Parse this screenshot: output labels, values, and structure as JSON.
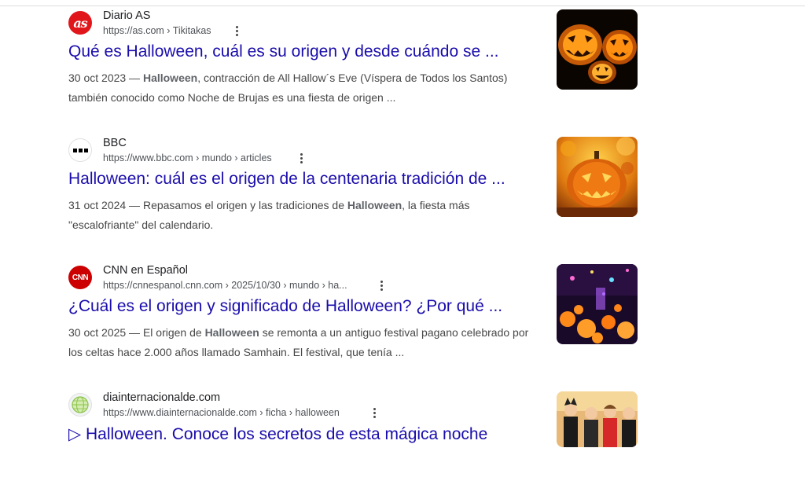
{
  "results": [
    {
      "site_name": "Diario AS",
      "url": "https://as.com › Tikitakas",
      "favicon_text": "as",
      "favicon_color": "#e1161b",
      "title": "Qué es Halloween, cuál es su origen y desde cuándo se ...",
      "snippet_date": "30 oct 2023",
      "snippet_highlight": "Halloween",
      "snippet_text": ", contracción de All Hallow´s Eve (Víspera de Todos los Santos) también conocido como Noche de Brujas es una fiesta de origen ...",
      "thumb_icon": "jack-o-lanterns-image"
    },
    {
      "site_name": "BBC",
      "url": "https://www.bbc.com › mundo › articles",
      "favicon_text": "",
      "favicon_color": "#000000",
      "title": "Halloween: cuál es el origen de la centenaria tradición de ...",
      "snippet_date": "31 oct 2024",
      "snippet_pre": "Repasamos el origen y las tradiciones de ",
      "snippet_highlight": "Halloween",
      "snippet_text": ", la fiesta más \"escalofriante\" del calendario.",
      "thumb_icon": "pumpkin-autumn-image"
    },
    {
      "site_name": "CNN en Español",
      "url": "https://cnnespanol.cnn.com › 2025/10/30 › mundo › ha...",
      "favicon_text": "CNN",
      "favicon_color": "#cc0000",
      "title": "¿Cuál es el origen y significado de Halloween? ¿Por qué ...",
      "snippet_date": "30 oct 2025",
      "snippet_pre": "El origen de ",
      "snippet_highlight": "Halloween",
      "snippet_text": " se remonta a un antiguo festival pagano celebrado por los celtas hace 2.000 años llamado Samhain. El festival, que tenía ...",
      "thumb_icon": "pumpkin-festival-image"
    },
    {
      "site_name": "diainternacionalde.com",
      "url": "https://www.diainternacionalde.com › ficha › halloween",
      "favicon_text": "",
      "favicon_color": "#8bc34a",
      "title": "▷ Halloween. Conoce los secretos de esta mágica noche",
      "thumb_icon": "children-costumes-image"
    }
  ],
  "separator": " — "
}
